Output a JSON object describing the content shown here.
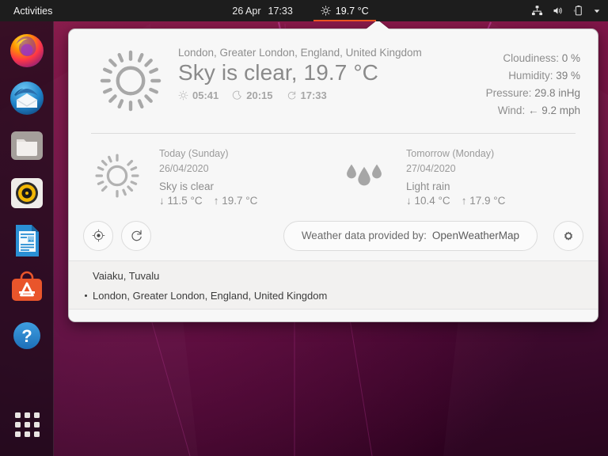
{
  "panel": {
    "activities": "Activities",
    "date": "26 Apr",
    "time": "17:33",
    "weather_temp": "19.7 °C",
    "weather_icon": "sun-icon",
    "tray": {
      "network_icon": "network-icon",
      "volume_icon": "volume-icon",
      "battery_icon": "battery-charging-icon",
      "menu_icon": "chevron-down-icon"
    }
  },
  "dock": {
    "items": [
      {
        "name": "firefox",
        "label": "Firefox"
      },
      {
        "name": "thunderbird",
        "label": "Thunderbird Mail"
      },
      {
        "name": "files",
        "label": "Files"
      },
      {
        "name": "rhythmbox",
        "label": "Rhythmbox"
      },
      {
        "name": "libreoffice-writer",
        "label": "LibreOffice Writer"
      },
      {
        "name": "ubuntu-software",
        "label": "Ubuntu Software"
      },
      {
        "name": "help",
        "label": "Help"
      }
    ],
    "app_grid_label": "Show Applications"
  },
  "weather": {
    "current": {
      "icon": "sun-icon",
      "location": "London, Greater London, England, United Kingdom",
      "summary": "Sky is clear, 19.7 °C",
      "sunrise": "05:41",
      "sunset": "20:15",
      "updated": "17:33",
      "sunrise_icon": "sunrise-icon",
      "sunset_icon": "moon-icon",
      "updated_icon": "refresh-icon",
      "stats": [
        {
          "label": "Cloudiness:",
          "value": "0 %"
        },
        {
          "label": "Humidity:",
          "value": "39 %"
        },
        {
          "label": "Pressure:",
          "value": "29.8 inHg"
        },
        {
          "label": "Wind:",
          "value": "← 9.2 mph"
        }
      ]
    },
    "forecast": [
      {
        "icon": "sun-icon",
        "day": "Today (Sunday)",
        "date": "26/04/2020",
        "condition": "Sky is clear",
        "temp_min": "↓ 11.5 °C",
        "temp_max": "↑ 19.7 °C"
      },
      {
        "icon": "rain-icon",
        "day": "Tomorrow (Monday)",
        "date": "27/04/2020",
        "condition": "Light rain",
        "temp_min": "↓ 10.4 °C",
        "temp_max": "↑ 17.9 °C"
      }
    ],
    "toolbar": {
      "locate_icon": "target-icon",
      "refresh_icon": "refresh-icon",
      "settings_icon": "gear-icon",
      "attribution_label": "Weather data provided by:",
      "attribution_provider": "OpenWeatherMap"
    },
    "locations": [
      {
        "text": "Vaiaku, Tuvalu",
        "selected": false
      },
      {
        "text": "London, Greater London, England, United Kingdom",
        "selected": true
      }
    ]
  },
  "colors": {
    "accent": "#e95420",
    "panel_bg": "#1d1d1d",
    "popup_bg": "#f7f7f7",
    "text_muted": "#8e8e8e"
  }
}
